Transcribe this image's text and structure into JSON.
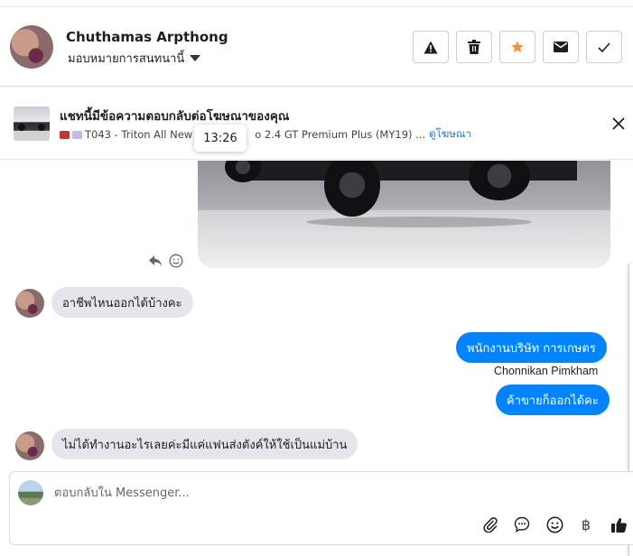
{
  "header": {
    "contact_name": "Chuthamas Arpthong",
    "assign_label": "มอบหมายการสนทนานี้",
    "buttons": [
      {
        "name": "report",
        "icon": "warning-icon"
      },
      {
        "name": "delete",
        "icon": "trash-icon"
      },
      {
        "name": "star",
        "icon": "star-icon",
        "color": "#f7923b"
      },
      {
        "name": "mark-unread",
        "icon": "envelope-icon"
      },
      {
        "name": "done",
        "icon": "check-icon"
      }
    ]
  },
  "ad_banner": {
    "title": "แชทนี้มีข้อความตอบกลับต่อโฆษณาของคุณ",
    "subtitle_left": "T043 - Triton All New I",
    "subtitle_right": "o 2.4 GT Premium Plus (MY19) ...",
    "link": "ดูโฆษณา",
    "tooltip_time": "13:26"
  },
  "messages": [
    {
      "direction": "in",
      "text": "อาชีพไหนออกได้บ้างคะ"
    },
    {
      "direction": "out",
      "text": "พนักงานบริษัท การเกษตร"
    },
    {
      "direction": "out_sender",
      "text": "Chonnikan Pimkham"
    },
    {
      "direction": "out",
      "text": "ค้าขายก็ออกได้คะ"
    },
    {
      "direction": "in",
      "text": "ไม่ได้ทำงานอะไรเลยค่ะมีแค่แฟนส่งตังค์ให้ใช้เป็นแม่บ้าน"
    }
  ],
  "composer": {
    "placeholder": "ตอบกลับใน Messenger...",
    "tools": [
      "paperclip-icon",
      "chat-bubble-icon",
      "emoji-icon",
      "baht-icon",
      "thumbs-up-icon"
    ],
    "baht_symbol": "฿"
  },
  "colors": {
    "accent": "#0084ff",
    "star": "#f7923b",
    "incoming_bubble": "#e4e6eb"
  }
}
